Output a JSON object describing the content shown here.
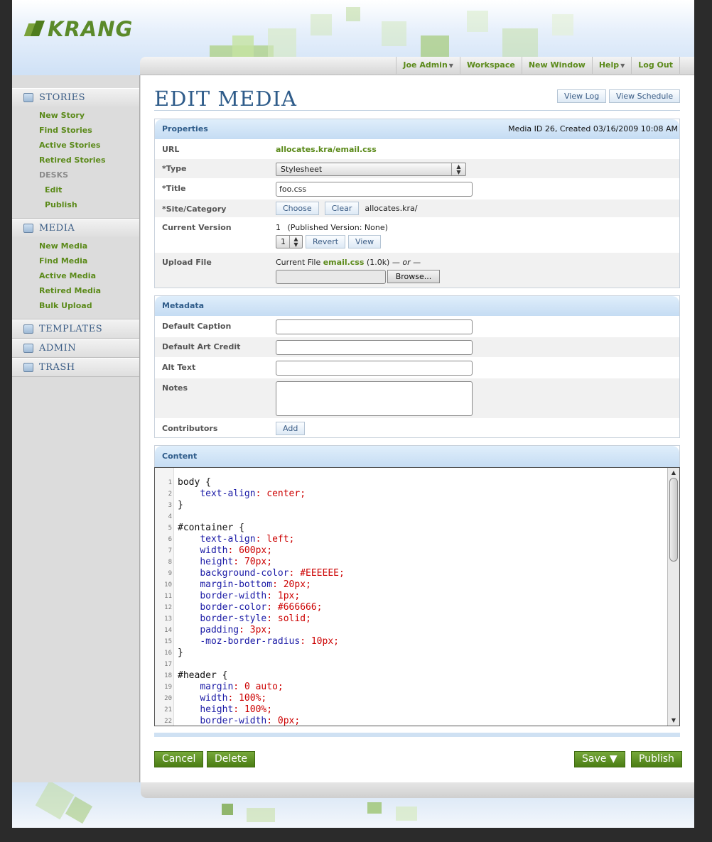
{
  "app": {
    "logo_text": "KRANG"
  },
  "topnav": [
    {
      "label": "Joe Admin",
      "dropdown": true
    },
    {
      "label": "Workspace",
      "dropdown": false
    },
    {
      "label": "New Window",
      "dropdown": false
    },
    {
      "label": "Help",
      "dropdown": true
    },
    {
      "label": "Log Out",
      "dropdown": false
    }
  ],
  "sidebar": {
    "stories": {
      "heading": "STORIES",
      "items": [
        "New Story",
        "Find Stories",
        "Active Stories",
        "Retired Stories"
      ],
      "desks_label": "DESKS",
      "desks": [
        "Edit",
        "Publish"
      ]
    },
    "media": {
      "heading": "MEDIA",
      "items": [
        "New Media",
        "Find Media",
        "Active Media",
        "Retired Media",
        "Bulk Upload"
      ]
    },
    "templates": {
      "heading": "TEMPLATES"
    },
    "admin": {
      "heading": "ADMIN"
    },
    "trash": {
      "heading": "TRASH"
    }
  },
  "page": {
    "title": "EDIT MEDIA",
    "view_log": "View Log",
    "view_schedule": "View Schedule"
  },
  "properties": {
    "heading": "Properties",
    "info": "Media ID 26, Created 03/16/2009 10:08 AM",
    "url_label": "URL",
    "url_value": "allocates.kra/email.css",
    "type_label": "*Type",
    "type_value": "Stylesheet",
    "title_label": "*Title",
    "title_value": "foo.css",
    "site_label": "*Site/Category",
    "choose": "Choose",
    "clear": "Clear",
    "site_value": "allocates.kra/",
    "version_label": "Current Version",
    "version_number": "1",
    "version_published": "(Published Version: None)",
    "version_select": "1",
    "revert": "Revert",
    "view": "View",
    "upload_label": "Upload File",
    "current_file_prefix": "Current File",
    "current_file_name": "email.css",
    "current_file_size": "(1.0k)",
    "current_file_or": "— or —",
    "browse": "Browse..."
  },
  "metadata": {
    "heading": "Metadata",
    "caption_label": "Default Caption",
    "caption_value": "",
    "art_credit_label": "Default Art Credit",
    "art_credit_value": "",
    "alt_text_label": "Alt Text",
    "alt_text_value": "",
    "notes_label": "Notes",
    "notes_value": "",
    "contributors_label": "Contributors",
    "add": "Add"
  },
  "content": {
    "heading": "Content",
    "lines": [
      {
        "n": "1",
        "sel": "body",
        "rest": " {"
      },
      {
        "n": "2",
        "prop": "text-align",
        "val": "center"
      },
      {
        "n": "3",
        "sel": "}",
        "rest": ""
      },
      {
        "n": "4",
        "sel": "",
        "rest": ""
      },
      {
        "n": "5",
        "sel": "#container",
        "rest": " {"
      },
      {
        "n": "6",
        "prop": "text-align",
        "val": "left"
      },
      {
        "n": "7",
        "prop": "width",
        "val": "600px"
      },
      {
        "n": "8",
        "prop": "height",
        "val": "70px"
      },
      {
        "n": "9",
        "prop": "background-color",
        "val": "#EEEEEE"
      },
      {
        "n": "10",
        "prop": "margin-bottom",
        "val": "20px"
      },
      {
        "n": "11",
        "prop": "border-width",
        "val": "1px"
      },
      {
        "n": "12",
        "prop": "border-color",
        "val": "#666666"
      },
      {
        "n": "13",
        "prop": "border-style",
        "val": "solid"
      },
      {
        "n": "14",
        "prop": "padding",
        "val": "3px"
      },
      {
        "n": "15",
        "prop": "-moz-border-radius",
        "val": "10px"
      },
      {
        "n": "16",
        "sel": "}",
        "rest": ""
      },
      {
        "n": "17",
        "sel": "",
        "rest": ""
      },
      {
        "n": "18",
        "sel": "#header",
        "rest": " {"
      },
      {
        "n": "19",
        "prop": "margin",
        "val": "0 auto"
      },
      {
        "n": "20",
        "prop": "width",
        "val": "100%"
      },
      {
        "n": "21",
        "prop": "height",
        "val": "100%"
      },
      {
        "n": "22",
        "prop": "border-width",
        "val": "0px"
      }
    ]
  },
  "actions": {
    "cancel": "Cancel",
    "delete": "Delete",
    "save": "Save ▼",
    "publish": "Publish"
  },
  "colors": {
    "accent_green": "#5b8a1a",
    "heading_blue": "#2f5c8a",
    "panel_head": "#c5dcf3"
  }
}
